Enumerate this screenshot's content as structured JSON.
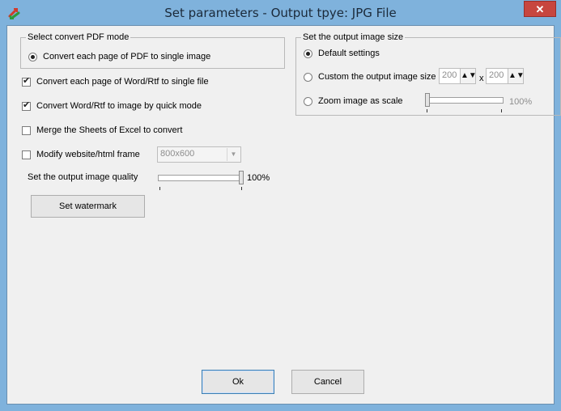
{
  "window": {
    "title": "Set parameters - Output tpye: JPG File",
    "close_glyph": "✕"
  },
  "pdf_group": {
    "title": "Select convert PDF mode",
    "option_label": "Convert each page of PDF to single image"
  },
  "options": {
    "word_single_file": {
      "label": "Convert each page of Word/Rtf to single file",
      "checked": true
    },
    "word_quick_mode": {
      "label": "Convert Word/Rtf to image by quick mode",
      "checked": true
    },
    "merge_excel": {
      "label": "Merge the Sheets of Excel to convert",
      "checked": false
    },
    "modify_html_frame": {
      "label": "Modify website/html frame",
      "checked": false,
      "select_value": "800x600"
    }
  },
  "quality": {
    "label": "Set the output image quality",
    "value_text": "100%",
    "value_fraction": 1.0
  },
  "watermark_button": {
    "label": "Set watermark"
  },
  "size_group": {
    "title": "Set the output image size",
    "default_label": "Default settings",
    "custom_label": "Custom the output image size",
    "custom_width": "200",
    "custom_separator": "x",
    "custom_height": "200",
    "zoom_label": "Zoom image as scale",
    "zoom_value_text": "100%",
    "zoom_fraction": 0.0,
    "selected": "default"
  },
  "footer": {
    "ok_label": "Ok",
    "cancel_label": "Cancel"
  },
  "icons": {
    "app": "arrow-convert-icon",
    "close": "close-icon",
    "spin": "spin-up-down-icon",
    "dropdown": "chevron-down-icon"
  }
}
